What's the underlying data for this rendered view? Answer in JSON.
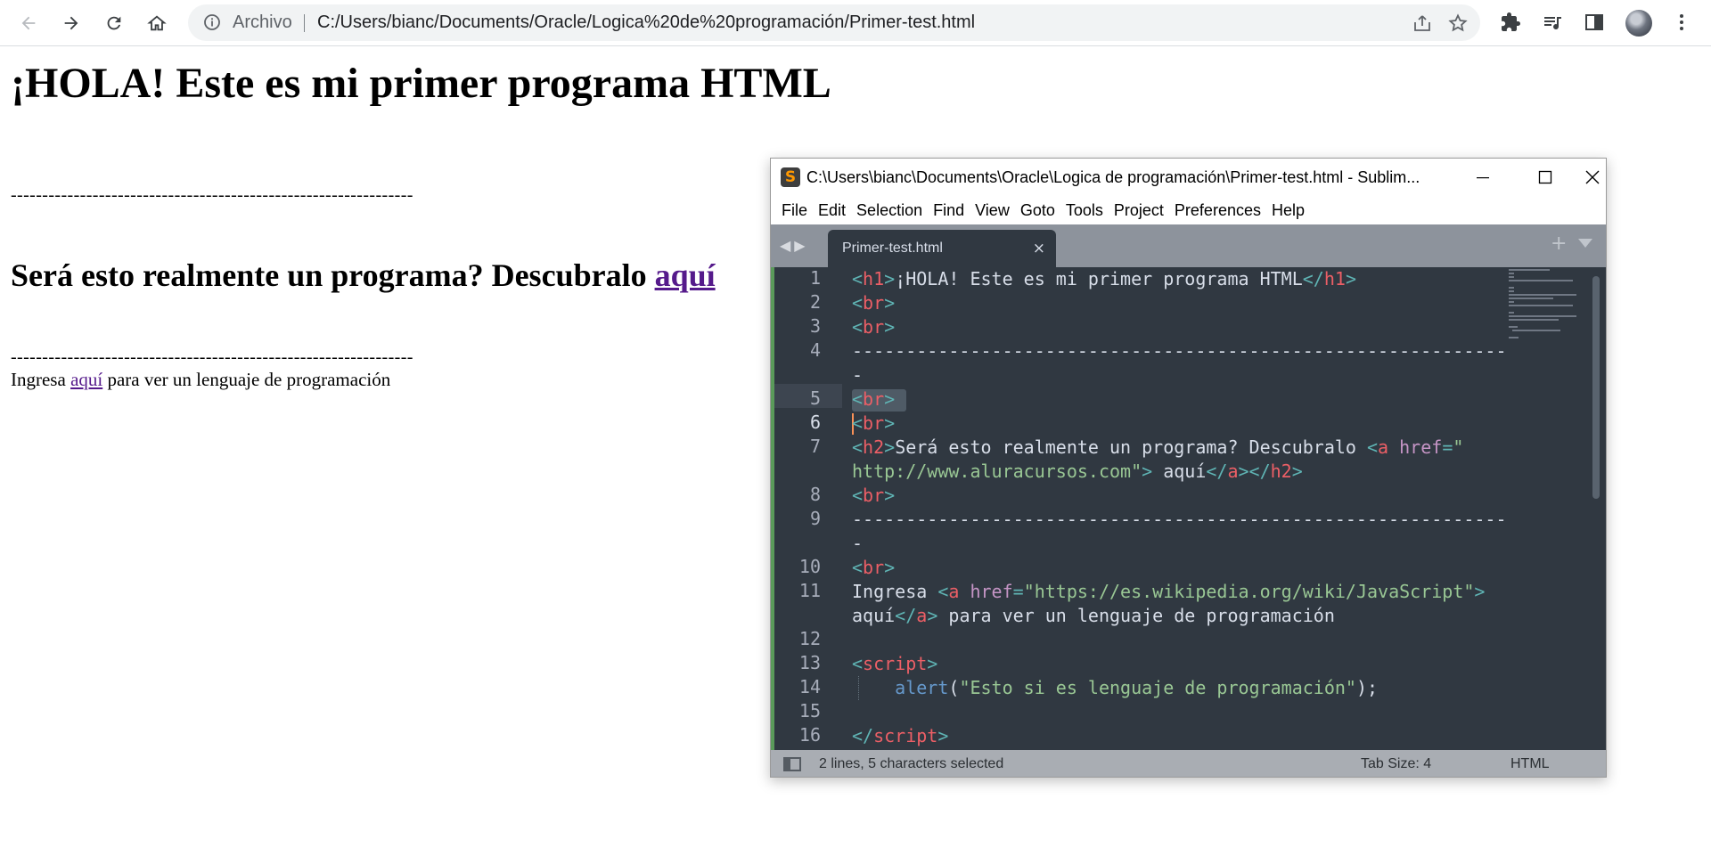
{
  "browser": {
    "scheme_label": "Archivo",
    "url": "C:/Users/bianc/Documents/Oracle/Logica%20de%20programación/Primer-test.html"
  },
  "page": {
    "heading": "¡HOLA! Este es mi primer programa HTML",
    "separator_1": "----------------------------------------------------------------",
    "subheading_text": "Será esto realmente un programa? Descubralo ",
    "subheading_link": "aquí",
    "separator_2": "----------------------------------------------------------------",
    "para_before": "Ingresa ",
    "para_link": "aquí",
    "para_after": " para ver un lenguaje de programación"
  },
  "editor": {
    "window_title": "C:\\Users\\bianc\\Documents\\Oracle\\Logica de programación\\Primer-test.html - Sublim...",
    "menu": [
      "File",
      "Edit",
      "Selection",
      "Find",
      "View",
      "Goto",
      "Tools",
      "Project",
      "Preferences",
      "Help"
    ],
    "tab_label": "Primer-test.html",
    "tab_close": "×",
    "line_numbers": [
      "1",
      "2",
      "3",
      "4",
      "5",
      "6",
      "7",
      "8",
      "9",
      "10",
      "11",
      "12",
      "13",
      "14",
      "15",
      "16"
    ],
    "code": {
      "l1_text": "¡HOLA! Este es mi primer programa HTML",
      "dashes": "-------------------------------------------------------------",
      "dash_tail": "-",
      "l7_text": "Será esto realmente un programa? Descubralo ",
      "l7_href": "\"",
      "l7_url": "http://www.aluracursos.com\"",
      "l7_link": " aquí",
      "l11_text": "Ingresa ",
      "l11_url": "\"https://es.wikipedia.org/wiki/JavaScript\"",
      "l11_link": "aquí",
      "l11_after": " para ver un lenguaje de programación",
      "l14_fn": "alert",
      "l14_str": "\"Esto si es lenguaje de programación\""
    },
    "status": {
      "selection": "2 lines, 5 characters selected",
      "tab_size": "Tab Size: 4",
      "syntax": "HTML"
    }
  }
}
